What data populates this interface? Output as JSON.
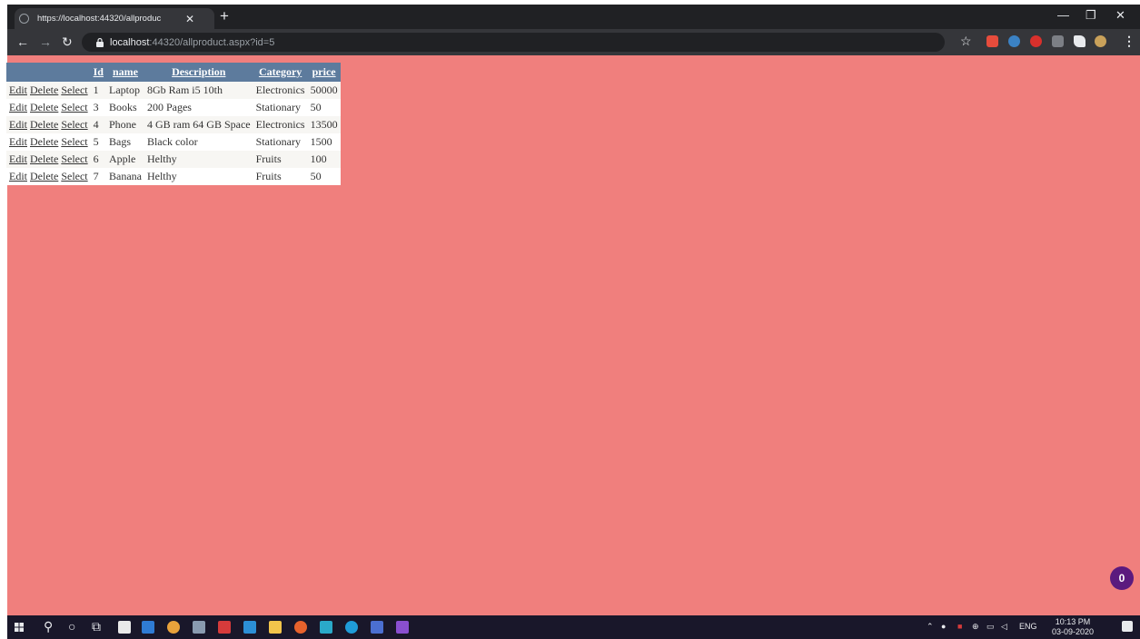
{
  "browser": {
    "tab_title": "https://localhost:44320/allproduc",
    "tab_close": "✕",
    "new_tab": "+",
    "url_host": "localhost",
    "url_path": ":44320/allproduct.aspx?id=5",
    "minimize": "—",
    "maximize": "❐",
    "close": "✕"
  },
  "grid": {
    "headers": [
      "Id",
      "name",
      "Description",
      "Category",
      "price"
    ],
    "commands": [
      "Edit",
      "Delete",
      "Select"
    ],
    "rows": [
      {
        "id": "1",
        "name": "Laptop",
        "description": "8Gb Ram i5 10th",
        "category": "Electronics",
        "price": "50000"
      },
      {
        "id": "3",
        "name": "Books",
        "description": "200 Pages",
        "category": "Stationary",
        "price": "50"
      },
      {
        "id": "4",
        "name": "Phone",
        "description": "4 GB ram 64 GB Space",
        "category": "Electronics",
        "price": "13500"
      },
      {
        "id": "5",
        "name": "Bags",
        "description": "Black color",
        "category": "Stationary",
        "price": "1500"
      },
      {
        "id": "6",
        "name": "Apple",
        "description": "Helthy",
        "category": "Fruits",
        "price": "100"
      },
      {
        "id": "7",
        "name": "Banana",
        "description": "Helthy",
        "category": "Fruits",
        "price": "50"
      }
    ]
  },
  "badge_count": "0",
  "taskbar": {
    "language": "ENG",
    "time": "10:13 PM",
    "date": "03-09-2020"
  },
  "colors": {
    "page_bg": "#f07f7d",
    "header_bg": "#5d7b9d",
    "row_odd": "#f7f6f3",
    "row_even": "#ffffff"
  }
}
